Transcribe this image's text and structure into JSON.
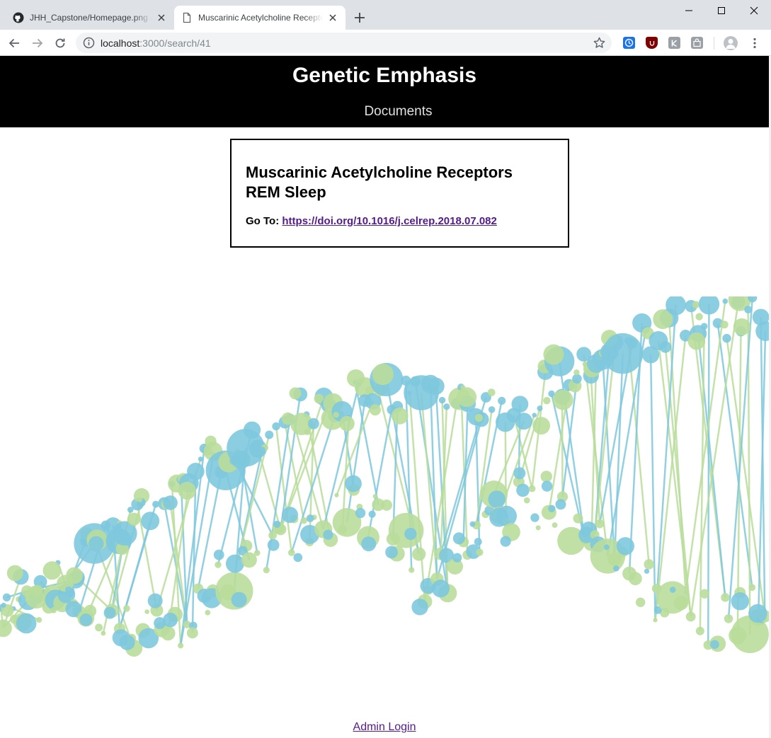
{
  "browser": {
    "tabs": [
      {
        "title": "JHH_Capstone/Homepage.png at master",
        "icon": "github-icon",
        "active": false
      },
      {
        "title": "Muscarinic Acetylcholine Receptors REM Sleep",
        "icon": "page-icon",
        "active": true
      }
    ],
    "url_host": "localhost",
    "url_path": ":3000/search/41",
    "extensions": [
      "clock-extension-icon",
      "ublock-icon",
      "k-extension-icon",
      "bag-extension-icon"
    ]
  },
  "site": {
    "title": "Genetic Emphasis",
    "nav": {
      "documents": "Documents"
    }
  },
  "document": {
    "title": "Muscarinic Acetylcholine Receptors REM Sleep",
    "goto_label": "Go To:",
    "doi_link": "https://doi.org/10.1016/j.celrep.2018.07.082"
  },
  "footer": {
    "admin_login": "Admin Login"
  },
  "colors": {
    "header_bg": "#000000",
    "blue_node": "#7ec8de",
    "green_node": "#b9dd9b",
    "overlap_node": "#86b993",
    "link_visited": "#551a8b"
  }
}
